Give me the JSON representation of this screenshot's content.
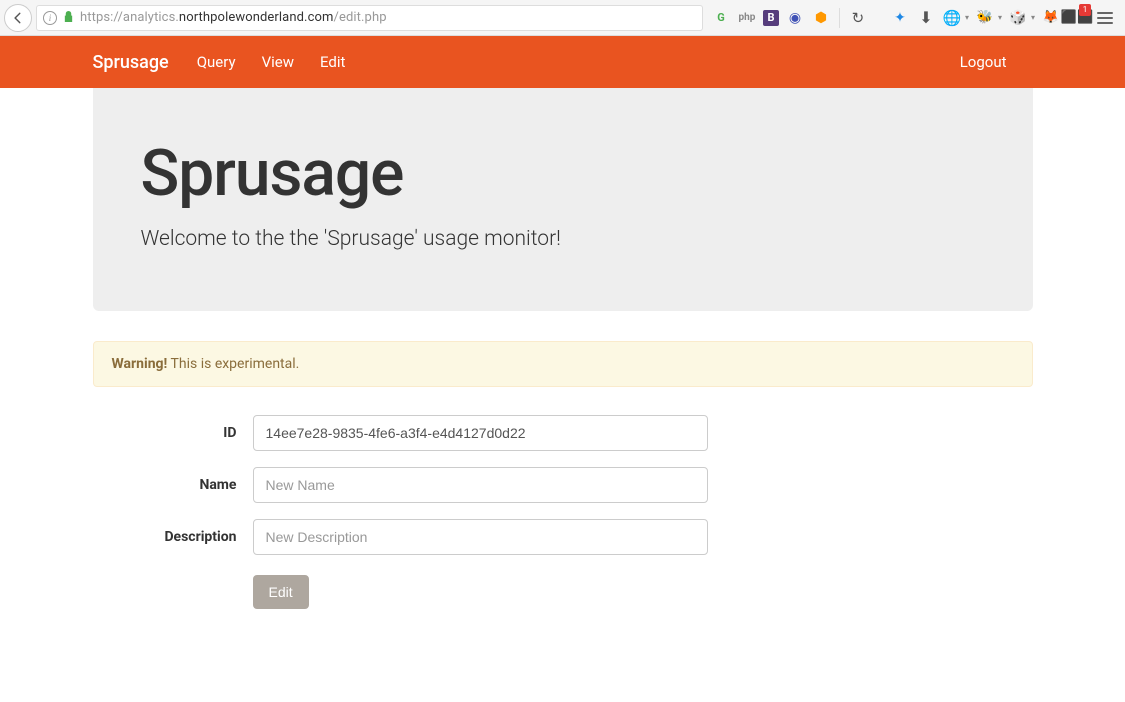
{
  "browser": {
    "url_prefix": "https://analytics.",
    "url_domain": "northpolewonderland.com",
    "url_path": "/edit.php",
    "badge_count": "1"
  },
  "navbar": {
    "brand": "Sprusage",
    "links": [
      "Query",
      "View",
      "Edit"
    ],
    "logout": "Logout"
  },
  "jumbotron": {
    "title": "Sprusage",
    "subtitle": "Welcome to the the 'Sprusage' usage monitor!"
  },
  "alert": {
    "strong": "Warning!",
    "text": " This is experimental."
  },
  "form": {
    "id_label": "ID",
    "id_value": "14ee7e28-9835-4fe6-a3f4-e4d4127d0d22",
    "name_label": "Name",
    "name_placeholder": "New Name",
    "desc_label": "Description",
    "desc_placeholder": "New Description",
    "submit_label": "Edit"
  }
}
